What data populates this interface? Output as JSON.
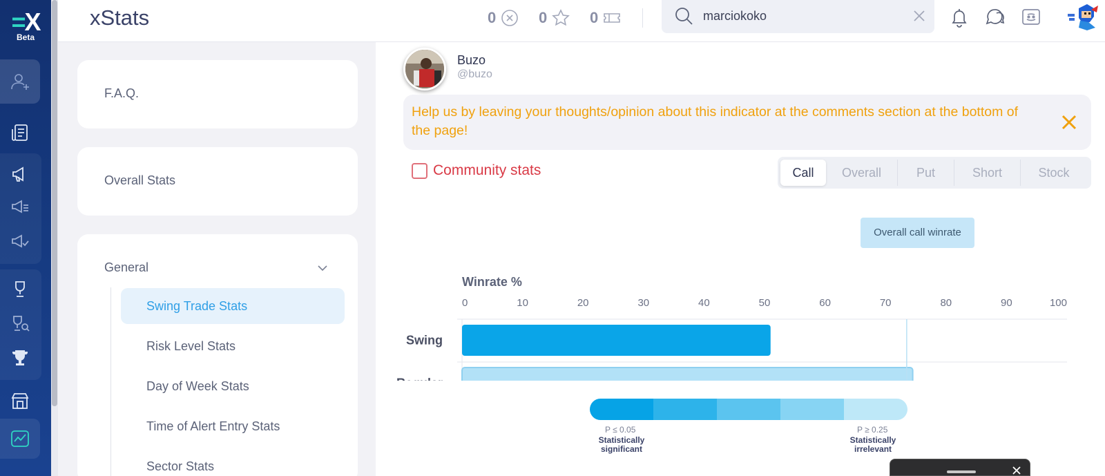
{
  "app": {
    "logo_mark": "X",
    "logo_badge": "Beta",
    "title": "xStats"
  },
  "header": {
    "counters": [
      {
        "value": "0",
        "icon": "x-coin-icon"
      },
      {
        "value": "0",
        "icon": "star-icon"
      },
      {
        "value": "0",
        "icon": "ticket-icon"
      }
    ],
    "search": {
      "value": "marciokoko",
      "placeholder": ""
    }
  },
  "menu": {
    "faq": "F.A.Q.",
    "overall": "Overall Stats",
    "general": "General",
    "subitems": [
      "Swing Trade Stats",
      "Risk Level Stats",
      "Day of Week Stats",
      "Time of Alert Entry Stats",
      "Sector Stats"
    ]
  },
  "profile": {
    "name": "Buzo",
    "handle": "@buzo"
  },
  "notice": "Help us by leaving your thoughts/opinion about this indicator at the comments section at the bottom of the page!",
  "community_label": "Community stats",
  "tabs": [
    "Call",
    "Overall",
    "Put",
    "Short",
    "Stock"
  ],
  "tooltip": "Overall call winrate",
  "chart_data": {
    "type": "bar",
    "orientation": "horizontal",
    "title": "Winrate %",
    "xlim": [
      0,
      100
    ],
    "ticks": [
      "0",
      "10",
      "20",
      "30",
      "40",
      "50",
      "60",
      "70",
      "80",
      "90",
      "100"
    ],
    "categories": [
      "Swing",
      "Regular"
    ],
    "values": [
      51,
      74.5
    ],
    "reference_line": 73.5,
    "colors": [
      "#0aa5e8",
      "#b2e1f7"
    ],
    "grid": true
  },
  "legend": {
    "colors": [
      "#06a3e6",
      "#2db3ea",
      "#5bc4ef",
      "#87d4f3",
      "#bee8f8"
    ],
    "left_p": "P ≤ 0.05",
    "left_desc_1": "Statistically",
    "left_desc_2": "significant",
    "right_p": "P ≥ 0.25",
    "right_desc_1": "Statistically",
    "right_desc_2": "irrelevant"
  }
}
